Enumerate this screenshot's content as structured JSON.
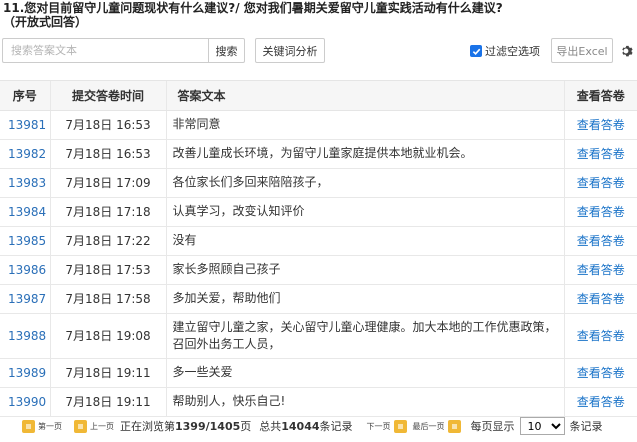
{
  "question": {
    "line1": "11.您对目前留守儿童问题现状有什么建议?/ 您对我们暑期关爱留守儿童实践活动有什么建议?",
    "line2": "（开放式回答）"
  },
  "toolbar": {
    "search_placeholder": "搜索答案文本",
    "search_label": "搜索",
    "keyword_label": "关键词分析",
    "filter_label": "过滤空选项",
    "filter_checked": true,
    "export_label": "导出Excel",
    "settings_icon": "gear-icon"
  },
  "table": {
    "headers": [
      "序号",
      "提交答卷时间",
      "答案文本",
      "查看答卷"
    ],
    "rows": [
      {
        "id": "13981",
        "time": "7月18日 16:53",
        "answer": "非常同意",
        "view": "查看答卷"
      },
      {
        "id": "13982",
        "time": "7月18日 16:53",
        "answer": "改善儿童成长环境，为留守儿童家庭提供本地就业机会。",
        "view": "查看答卷"
      },
      {
        "id": "13983",
        "time": "7月18日 17:09",
        "answer": "各位家长们多回来陪陪孩子，",
        "view": "查看答卷"
      },
      {
        "id": "13984",
        "time": "7月18日 17:18",
        "answer": "认真学习，改变认知评价",
        "view": "查看答卷"
      },
      {
        "id": "13985",
        "time": "7月18日 17:22",
        "answer": "没有",
        "view": "查看答卷"
      },
      {
        "id": "13986",
        "time": "7月18日 17:53",
        "answer": "家长多照顾自己孩子",
        "view": "查看答卷"
      },
      {
        "id": "13987",
        "time": "7月18日 17:58",
        "answer": "多加关爱，帮助他们",
        "view": "查看答卷"
      },
      {
        "id": "13988",
        "time": "7月18日 19:08",
        "answer": "建立留守儿童之家，关心留守儿童心理健康。加大本地的工作优惠政策，召回外出务工人员，",
        "view": "查看答卷"
      },
      {
        "id": "13989",
        "time": "7月18日 19:11",
        "answer": "多一些关爱",
        "view": "查看答卷"
      },
      {
        "id": "13990",
        "time": "7月18日 19:11",
        "answer": "帮助别人，快乐自己!",
        "view": "查看答卷"
      }
    ]
  },
  "pager": {
    "first": "第一页",
    "prev": "上一页",
    "browsing_prefix": "正在浏览第",
    "browsing_value": "1399/1405",
    "browsing_suffix": "页",
    "total_prefix": "总共",
    "total_value": "14044",
    "total_suffix": "条记录",
    "next": "下一页",
    "last": "最后一页",
    "per_page_prefix": "每页显示",
    "per_page_value": "10",
    "per_page_suffix": "条记录"
  },
  "colors": {
    "link": "#2a6fb8",
    "view_link": "#1a73c8",
    "checkbox": "#1a73e8",
    "pager_icon": "#f0b836"
  }
}
